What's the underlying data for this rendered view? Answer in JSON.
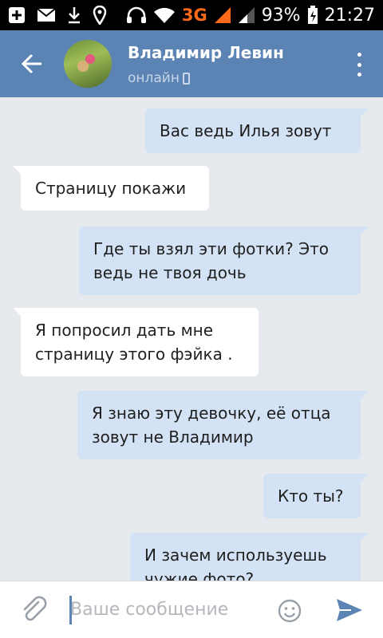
{
  "status_bar": {
    "network": "3G",
    "battery": "93%",
    "time": "21:27",
    "icons": [
      "plus-icon",
      "mail-icon",
      "download-icon",
      "location-icon",
      "headphones-icon",
      "wifi-icon",
      "signal-icon",
      "signal-icon-2",
      "battery-icon"
    ]
  },
  "header": {
    "name": "Владимир Левин",
    "status": "онлайн",
    "color": "#5b83b3"
  },
  "messages": [
    {
      "direction": "out",
      "lines": [
        "Вас ведь Илья зовут"
      ]
    },
    {
      "direction": "in",
      "lines": [
        "Страницу покажи"
      ]
    },
    {
      "direction": "out",
      "lines": [
        "Где ты взял эти фотки? Это",
        "ведь не твоя дочь"
      ]
    },
    {
      "direction": "in",
      "lines": [
        "Я попросил дать мне",
        "страницу этого фэйка ."
      ]
    },
    {
      "direction": "out",
      "lines": [
        "Я знаю эту девочку, её отца",
        "зовут не Владимир"
      ]
    },
    {
      "direction": "out",
      "lines": [
        "Кто ты?"
      ]
    },
    {
      "direction": "out",
      "lines": [
        "И зачем используешь",
        "чужие фото?"
      ]
    }
  ],
  "composer": {
    "placeholder": "Ваше сообщение",
    "value": ""
  },
  "colors": {
    "outgoing_bubble": "#d3e2f4",
    "incoming_bubble": "#ffffff",
    "background": "#e6e9ee"
  }
}
